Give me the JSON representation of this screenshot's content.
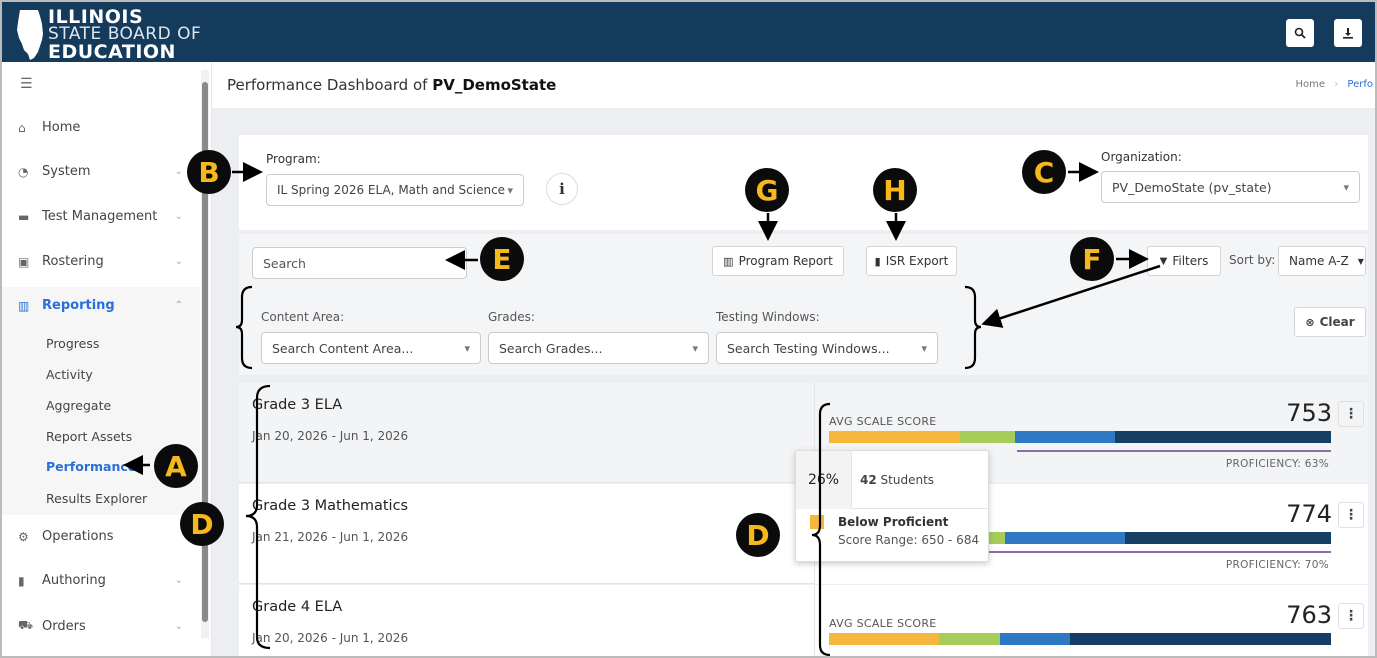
{
  "header": {
    "logo_line1": "ILLINOIS",
    "logo_line2": "STATE BOARD OF",
    "logo_line3": "EDUCATION",
    "search_icon": "search-icon",
    "download_icon": "download-icon"
  },
  "sidebar": {
    "menu_icon": "☰",
    "items": [
      {
        "label": "Home",
        "icon": "home-icon"
      },
      {
        "label": "System",
        "icon": "gauge-icon"
      },
      {
        "label": "Test Management",
        "icon": "folder-icon"
      },
      {
        "label": "Rostering",
        "icon": "badge-icon"
      },
      {
        "label": "Reporting",
        "icon": "chart-icon"
      },
      {
        "label": "Operations",
        "icon": "cogs-icon"
      },
      {
        "label": "Authoring",
        "icon": "book-icon"
      },
      {
        "label": "Orders",
        "icon": "cart-icon"
      }
    ],
    "reporting_sub": [
      "Progress",
      "Activity",
      "Aggregate",
      "Report Assets",
      "Performance",
      "Results Explorer"
    ]
  },
  "page": {
    "title_prefix": "Performance Dashboard of",
    "title_name": "PV_DemoState",
    "crumb_home": "Home",
    "crumb_sep": "›",
    "crumb_current": "Perfo"
  },
  "program": {
    "label": "Program:",
    "value": "IL Spring 2026 ELA, Math and Science"
  },
  "organization": {
    "label": "Organization:",
    "value": "PV_DemoState (pv_state)"
  },
  "toolbar": {
    "search_placeholder": "Search",
    "program_report": "Program Report",
    "isr_export": "ISR Export",
    "filters": "Filters",
    "sort_label": "Sort by:",
    "sort_value": "Name A-Z"
  },
  "filters": {
    "content_area_label": "Content Area:",
    "content_area_placeholder": "Search Content Area...",
    "grades_label": "Grades:",
    "grades_placeholder": "Search Grades...",
    "windows_label": "Testing Windows:",
    "windows_placeholder": "Search Testing Windows...",
    "clear": "Clear"
  },
  "rows": [
    {
      "name": "Grade 3 ELA",
      "date": "Jan 20, 2026 - Jun 1, 2026",
      "avg_label": "AVG SCALE SCORE",
      "score": "753",
      "proficiency": "PROFICIENCY: 63%",
      "segments": [
        0.26,
        0.11,
        0.2,
        0.43
      ]
    },
    {
      "name": "Grade 3 Mathematics",
      "date": "Jan 21, 2026 - Jun 1, 2026",
      "avg_label": "",
      "score": "774",
      "proficiency": "PROFICIENCY: 70%",
      "segments": [
        0.26,
        0.09,
        0.24,
        0.41
      ]
    },
    {
      "name": "Grade 4 ELA",
      "date": "Jan 20, 2026 - Jun 1, 2026",
      "avg_label": "AVG SCALE SCORE",
      "score": "763",
      "proficiency": "",
      "segments": [
        0.22,
        0.12,
        0.14,
        0.52
      ]
    }
  ],
  "tooltip": {
    "percent": "26%",
    "count": "42",
    "count_label": "Students",
    "level": "Below Proficient",
    "range": "Score Range: 650 - 684"
  },
  "colors": {
    "header": "#143a5c",
    "accent": "#2a6fd6",
    "below": "#f6b83c",
    "approaching": "#a6cd5a",
    "proficient": "#2f78c4",
    "advanced": "#163f66",
    "callout_bg": "#0b0b0b",
    "callout_fg": "#f6b81a"
  },
  "callouts": [
    "A",
    "B",
    "C",
    "D",
    "D",
    "E",
    "F",
    "G",
    "H"
  ]
}
